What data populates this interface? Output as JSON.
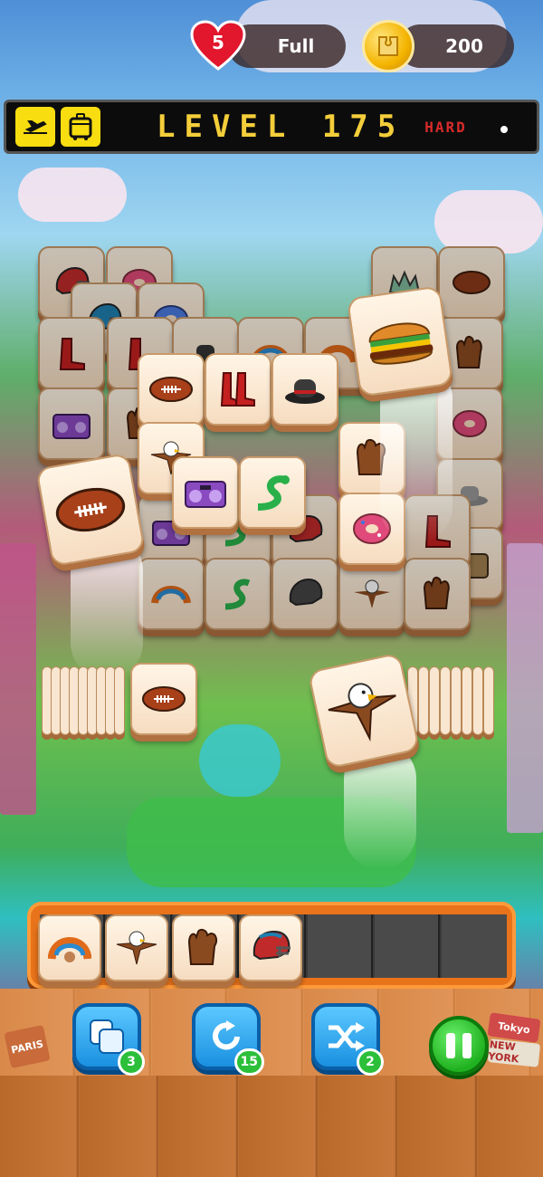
{
  "header": {
    "lives": "5",
    "lives_status": "Full",
    "coins": "200"
  },
  "level_bar": {
    "level_label": "LEVEL 175",
    "difficulty": "HARD"
  },
  "boosters": [
    {
      "name": "undo",
      "count": "3"
    },
    {
      "name": "rotate",
      "count": "15"
    },
    {
      "name": "shuffle",
      "count": "2"
    }
  ],
  "tray": {
    "capacity": 7,
    "slots": [
      "headdress",
      "eagle",
      "baseball-glove",
      "football-helmet",
      "",
      "",
      ""
    ]
  },
  "tags": {
    "left_tag": "PARIS",
    "right_tag_1": "Tokyo",
    "right_tag_2": "NEW YORK"
  },
  "colors": {
    "accent": "#e8731a",
    "booster": "#1a90e0",
    "pause": "#1fb11f",
    "level_text": "#f4ce3a",
    "difficulty": "#d92b2b"
  }
}
